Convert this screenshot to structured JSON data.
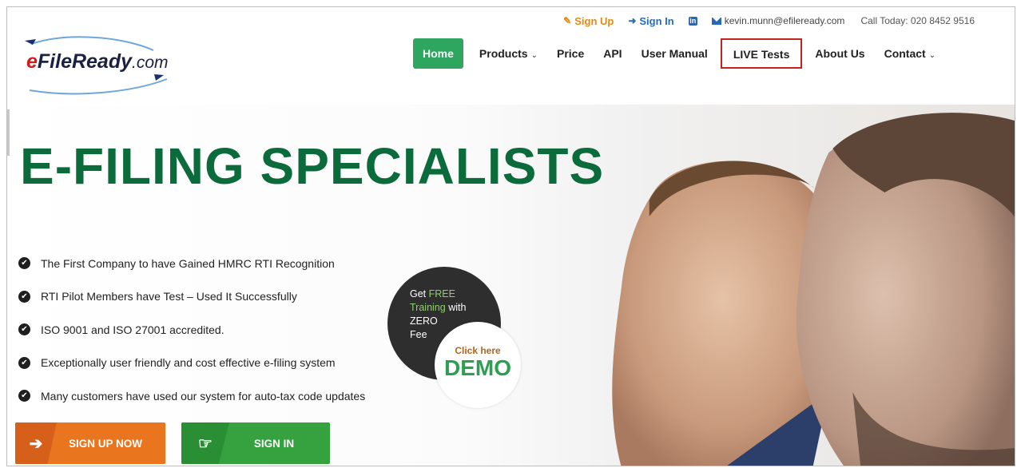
{
  "topbar": {
    "signup": "Sign Up",
    "signin": "Sign In",
    "linkedin_icon": "linkedin-icon",
    "email": "kevin.munn@efileready.com",
    "call": "Call Today: 020 8452 9516"
  },
  "logo": {
    "e": "e",
    "name": "FileReady",
    "suffix": ".com"
  },
  "nav": {
    "items": [
      {
        "label": "Home"
      },
      {
        "label": "Products"
      },
      {
        "label": "Price"
      },
      {
        "label": "API"
      },
      {
        "label": "User Manual"
      },
      {
        "label": "LIVE Tests"
      },
      {
        "label": "About Us"
      },
      {
        "label": "Contact"
      }
    ]
  },
  "hero": {
    "title": "E-FILING SPECIALISTS",
    "features": [
      "The First Company to have Gained HMRC RTI Recognition",
      "RTI Pilot Members have Test – Used It Successfully",
      "ISO 9001 and ISO 27001 accredited.",
      "Exceptionally user friendly and cost effective e-filing system",
      "Many customers have used our system for auto-tax code updates"
    ],
    "badge": {
      "get": "Get",
      "free": "FREE",
      "training": "Training",
      "with": "with",
      "zero": "ZERO",
      "fee": "Fee",
      "click_here": "Click here",
      "demo": "DEMO"
    },
    "buttons": {
      "signup": "SIGN UP NOW",
      "signin": "SIGN IN"
    }
  },
  "colors": {
    "brand_green": "#0b6b3a",
    "nav_active": "#2fa660",
    "signup_orange": "#e9761e",
    "signin_green": "#36a23f",
    "highlight_red": "#c4231f"
  }
}
